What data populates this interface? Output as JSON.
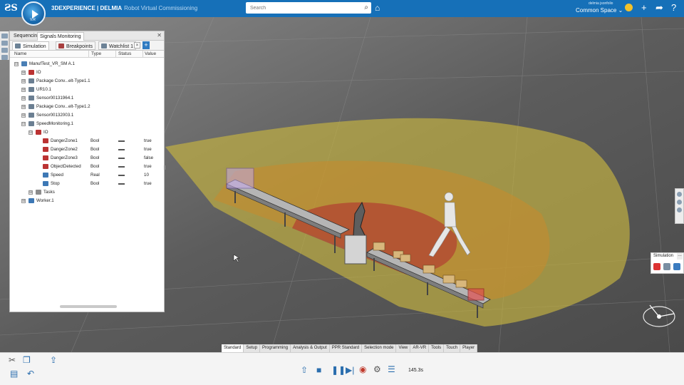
{
  "header": {
    "brand_bold": "3DEXPERIENCE | DELMIA",
    "app_name": "Robot Virtual Commissioning",
    "compass_version": "V.R",
    "search_placeholder": "Search",
    "user_name": "delmia jsonfolio",
    "space": "Common Space",
    "icons": [
      "tag-icon",
      "add-icon",
      "share-icon",
      "help-icon"
    ]
  },
  "panel": {
    "tabs": [
      "Sequencing",
      "Signals Monitoring"
    ],
    "subtabs": [
      "Simulation",
      "Breakpoints",
      "Watchlist 1"
    ],
    "columns": [
      "Name",
      "Type",
      "Status",
      "Value"
    ],
    "rows": [
      {
        "level": 0,
        "exp": "⊟",
        "name": "ManufTest_VR_SM A.1",
        "type": "",
        "value": "",
        "icon": "#4a7fb5"
      },
      {
        "level": 1,
        "exp": "⊞",
        "name": "IO",
        "type": "",
        "value": "",
        "icon": "#b33"
      },
      {
        "level": 1,
        "exp": "⊞",
        "name": "Package Conv...elt-Type1.1",
        "type": "",
        "value": "",
        "icon": "#6b7f92"
      },
      {
        "level": 1,
        "exp": "⊞",
        "name": "UR10.1",
        "type": "",
        "value": "",
        "icon": "#6b7f92"
      },
      {
        "level": 1,
        "exp": "⊞",
        "name": "Sensor00131964.1",
        "type": "",
        "value": "",
        "icon": "#6b7f92"
      },
      {
        "level": 1,
        "exp": "⊞",
        "name": "Package Conv...elt-Type1.2",
        "type": "",
        "value": "",
        "icon": "#6b7f92"
      },
      {
        "level": 1,
        "exp": "⊞",
        "name": "Sensor00132003.1",
        "type": "",
        "value": "",
        "icon": "#6b7f92"
      },
      {
        "level": 1,
        "exp": "⊟",
        "name": "SpeedMonitoring.1",
        "type": "",
        "value": "",
        "icon": "#6b7f92"
      },
      {
        "level": 2,
        "exp": "⊟",
        "name": "IO",
        "type": "",
        "value": "",
        "icon": "#b33"
      },
      {
        "level": 3,
        "exp": "",
        "name": "DangerZone1",
        "type": "Bool",
        "value": "true",
        "icon": "#b33",
        "status": true
      },
      {
        "level": 3,
        "exp": "",
        "name": "DangerZone2",
        "type": "Bool",
        "value": "true",
        "icon": "#b33",
        "status": true
      },
      {
        "level": 3,
        "exp": "",
        "name": "DangerZone3",
        "type": "Bool",
        "value": "false",
        "icon": "#b33",
        "status": true
      },
      {
        "level": 3,
        "exp": "",
        "name": "ObjectDetected",
        "type": "Bool",
        "value": "true",
        "icon": "#b33",
        "status": true
      },
      {
        "level": 3,
        "exp": "",
        "name": "Speed",
        "type": "Real",
        "value": "10",
        "icon": "#3d78b5",
        "status": true
      },
      {
        "level": 3,
        "exp": "",
        "name": "Stop",
        "type": "Bool",
        "value": "true",
        "icon": "#3d78b5",
        "status": true
      },
      {
        "level": 2,
        "exp": "⊞",
        "name": "Tasks",
        "type": "",
        "value": "",
        "icon": "#8c8c8c"
      },
      {
        "level": 1,
        "exp": "⊞",
        "name": "Worker.1",
        "type": "",
        "value": "",
        "icon": "#3d78b5"
      }
    ]
  },
  "sim_panel": {
    "title": "Simulation"
  },
  "action_tabs": [
    "Standard",
    "Setup",
    "Programming",
    "Analysis & Output",
    "PPR Standard",
    "Selection mode",
    "View",
    "AR-VR",
    "Tools",
    "Touch",
    "Player"
  ],
  "active_action_tab": "Standard",
  "player": {
    "time": "145.3s"
  }
}
